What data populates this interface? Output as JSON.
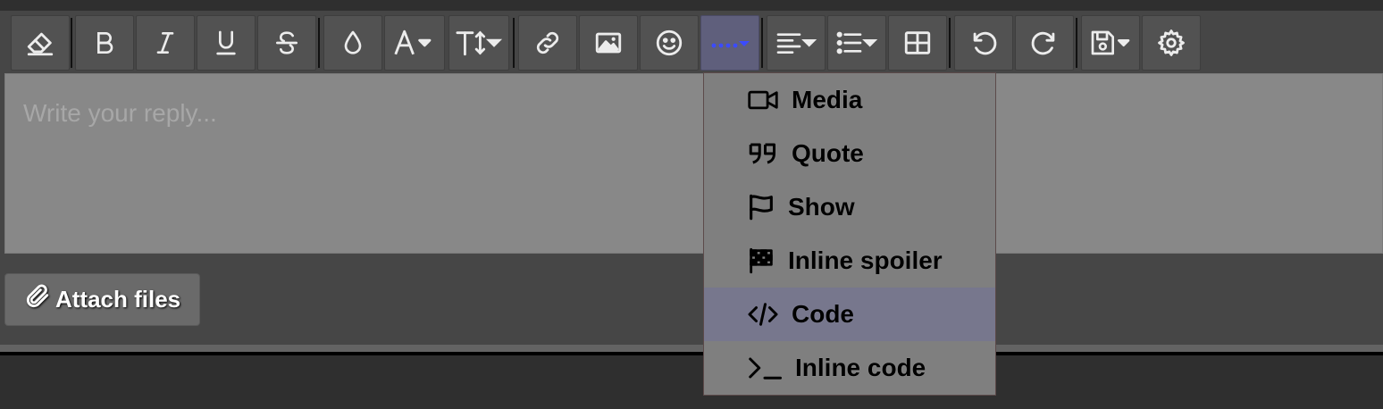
{
  "toolbar": {
    "buttons": [
      {
        "id": "remove-format",
        "icon": "eraser-icon",
        "has_caret": false
      },
      {
        "id": "bold",
        "icon": "bold-icon",
        "has_caret": false
      },
      {
        "id": "italic",
        "icon": "italic-icon",
        "has_caret": false
      },
      {
        "id": "underline",
        "icon": "underline-icon",
        "has_caret": false
      },
      {
        "id": "strikethrough",
        "icon": "strikethrough-icon",
        "has_caret": false
      },
      {
        "id": "text-color",
        "icon": "droplet-icon",
        "has_caret": false
      },
      {
        "id": "font-family",
        "icon": "font-icon",
        "has_caret": true
      },
      {
        "id": "font-size",
        "icon": "text-size-icon",
        "has_caret": true
      },
      {
        "id": "link",
        "icon": "link-icon",
        "has_caret": false
      },
      {
        "id": "image",
        "icon": "image-icon",
        "has_caret": false
      },
      {
        "id": "emoji",
        "icon": "smiley-icon",
        "has_caret": false
      },
      {
        "id": "more-options",
        "icon": "ellipsis-icon",
        "has_caret": true,
        "active": true
      },
      {
        "id": "align",
        "icon": "align-left-icon",
        "has_caret": true
      },
      {
        "id": "list",
        "icon": "list-icon",
        "has_caret": true
      },
      {
        "id": "table",
        "icon": "table-icon",
        "has_caret": false
      },
      {
        "id": "undo",
        "icon": "undo-icon",
        "has_caret": false
      },
      {
        "id": "redo",
        "icon": "redo-icon",
        "has_caret": false
      },
      {
        "id": "drafts",
        "icon": "floppy-disk-icon",
        "has_caret": true
      },
      {
        "id": "settings",
        "icon": "gear-icon",
        "has_caret": false
      }
    ]
  },
  "editor": {
    "placeholder": "Write your reply..."
  },
  "attach": {
    "label": "Attach files",
    "icon": "paperclip-icon"
  },
  "dropdown": {
    "items": [
      {
        "label": "Media",
        "icon": "video-camera-icon"
      },
      {
        "label": "Quote",
        "icon": "quote-icon"
      },
      {
        "label": "Show",
        "icon": "flag-icon"
      },
      {
        "label": "Inline spoiler",
        "icon": "checkered-flag-icon"
      },
      {
        "label": "Code",
        "icon": "code-icon",
        "highlighted": true
      },
      {
        "label": "Inline code",
        "icon": "terminal-icon"
      }
    ]
  },
  "colors": {
    "toolbar_bg": "#464646",
    "button_bg": "#525252",
    "active_button_bg": "#5f5f7c",
    "ellipsis_accent": "#3b4bff",
    "editor_bg": "#888888",
    "dropdown_bg": "#7f7f7f",
    "dropdown_highlight": "#77778d"
  }
}
